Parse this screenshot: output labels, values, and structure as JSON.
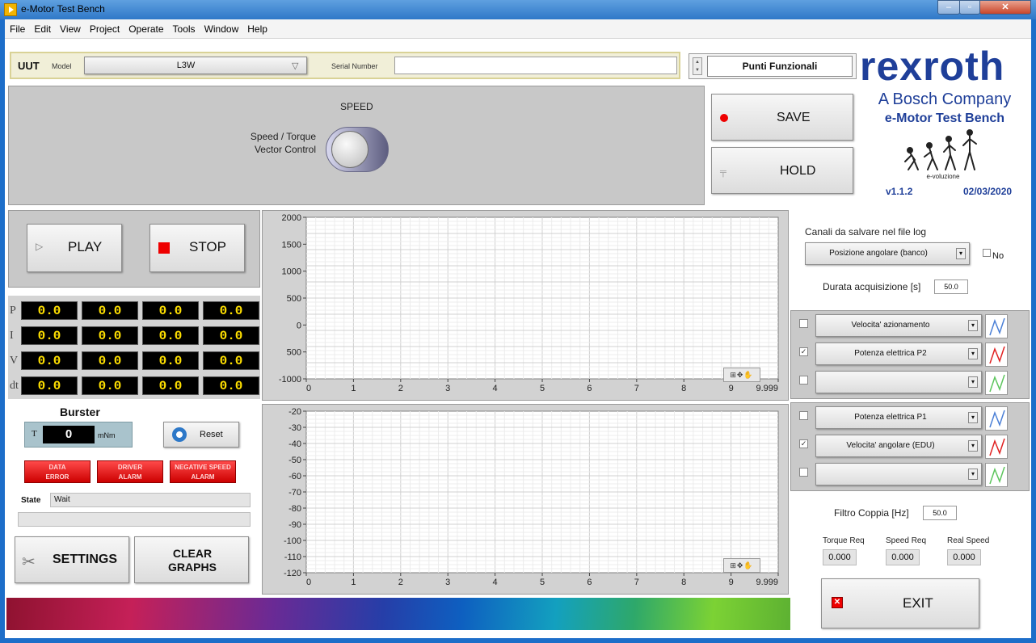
{
  "window": {
    "title": "e-Motor Test Bench"
  },
  "menu": [
    "File",
    "Edit",
    "View",
    "Project",
    "Operate",
    "Tools",
    "Window",
    "Help"
  ],
  "uut": {
    "label": "UUT",
    "model_label": "Model",
    "model_value": "L3W",
    "serial_label": "Serial Number",
    "serial_value": ""
  },
  "punti": {
    "label": "Punti Funzionali"
  },
  "speed": {
    "title": "SPEED",
    "mode_line1": "Speed / Torque",
    "mode_line2": "Vector Control"
  },
  "buttons": {
    "save": "SAVE",
    "hold": "HOLD",
    "play": "PLAY",
    "stop": "STOP",
    "reset": "Reset",
    "settings": "SETTINGS",
    "clear_line1": "CLEAR",
    "clear_line2": "GRAPHS",
    "exit": "EXIT"
  },
  "logo": {
    "brand": "rexroth",
    "subtitle": "A Bosch Company",
    "product": "e-Motor Test Bench",
    "evolution_label": "e-voluzione",
    "version": "v1.1.2",
    "date": "02/03/2020"
  },
  "meters": [
    {
      "label": "P",
      "values": [
        "0.0",
        "0.0",
        "0.0",
        "0.0"
      ]
    },
    {
      "label": "I",
      "values": [
        "0.0",
        "0.0",
        "0.0",
        "0.0"
      ]
    },
    {
      "label": "V",
      "values": [
        "0.0",
        "0.0",
        "0.0",
        "0.0"
      ]
    },
    {
      "label": "dt",
      "values": [
        "0.0",
        "0.0",
        "0.0",
        "0.0"
      ]
    }
  ],
  "burster": {
    "title": "Burster",
    "symbol": "T",
    "value": "0",
    "unit": "mNm"
  },
  "alarms": [
    {
      "line1": "DATA",
      "line2": "ERROR"
    },
    {
      "line1": "DRIVER",
      "line2": "ALARM"
    },
    {
      "line1": "NEGATIVE SPEED",
      "line2": "ALARM"
    }
  ],
  "state": {
    "label": "State",
    "value": "Wait"
  },
  "chart_data": [
    {
      "type": "line",
      "title": "",
      "xlabel": "",
      "ylabel": "",
      "xlim": [
        0,
        9.999
      ],
      "ylim": [
        -1000,
        2000
      ],
      "x_ticks": [
        "0",
        "1",
        "2",
        "3",
        "4",
        "5",
        "6",
        "7",
        "8",
        "9",
        "9.999"
      ],
      "y_ticks": [
        "2000",
        "1500",
        "1000",
        "500",
        "0",
        "500",
        "-1000"
      ],
      "grid": true,
      "series": []
    },
    {
      "type": "line",
      "title": "",
      "xlabel": "",
      "ylabel": "",
      "xlim": [
        0,
        9.999
      ],
      "ylim": [
        -120,
        -20
      ],
      "x_ticks": [
        "0",
        "1",
        "2",
        "3",
        "4",
        "5",
        "6",
        "7",
        "8",
        "9",
        "9.999"
      ],
      "y_ticks": [
        "-20",
        "-30",
        "-40",
        "-50",
        "-60",
        "-70",
        "-80",
        "-90",
        "-100",
        "-110",
        "-120"
      ],
      "grid": true,
      "series": []
    }
  ],
  "chart_tools": "⊞✥✋",
  "log": {
    "title": "Canali da salvare nel file log",
    "channel": "Posizione angolare (banco)",
    "no_label": "No",
    "durata_label": "Durata acquisizione [s]",
    "durata_value": "50.0"
  },
  "channel_groups": [
    [
      {
        "checked": false,
        "label": "Velocita' azionamento",
        "color": "#4a7fd6"
      },
      {
        "checked": true,
        "label": "Potenza elettrica P2",
        "color": "#e02020"
      },
      {
        "checked": false,
        "label": "",
        "color": "#5cc55c"
      }
    ],
    [
      {
        "checked": false,
        "label": "Potenza elettrica P1",
        "color": "#4a7fd6"
      },
      {
        "checked": true,
        "label": "Velocita' angolare (EDU)",
        "color": "#e02020"
      },
      {
        "checked": false,
        "label": "",
        "color": "#5cc55c"
      }
    ]
  ],
  "filtro": {
    "label": "Filtro Coppia [Hz]",
    "value": "50.0"
  },
  "indicators": [
    {
      "label": "Torque Req",
      "value": "0.000"
    },
    {
      "label": "Speed Req",
      "value": "0.000"
    },
    {
      "label": "Real Speed",
      "value": "0.000"
    }
  ]
}
